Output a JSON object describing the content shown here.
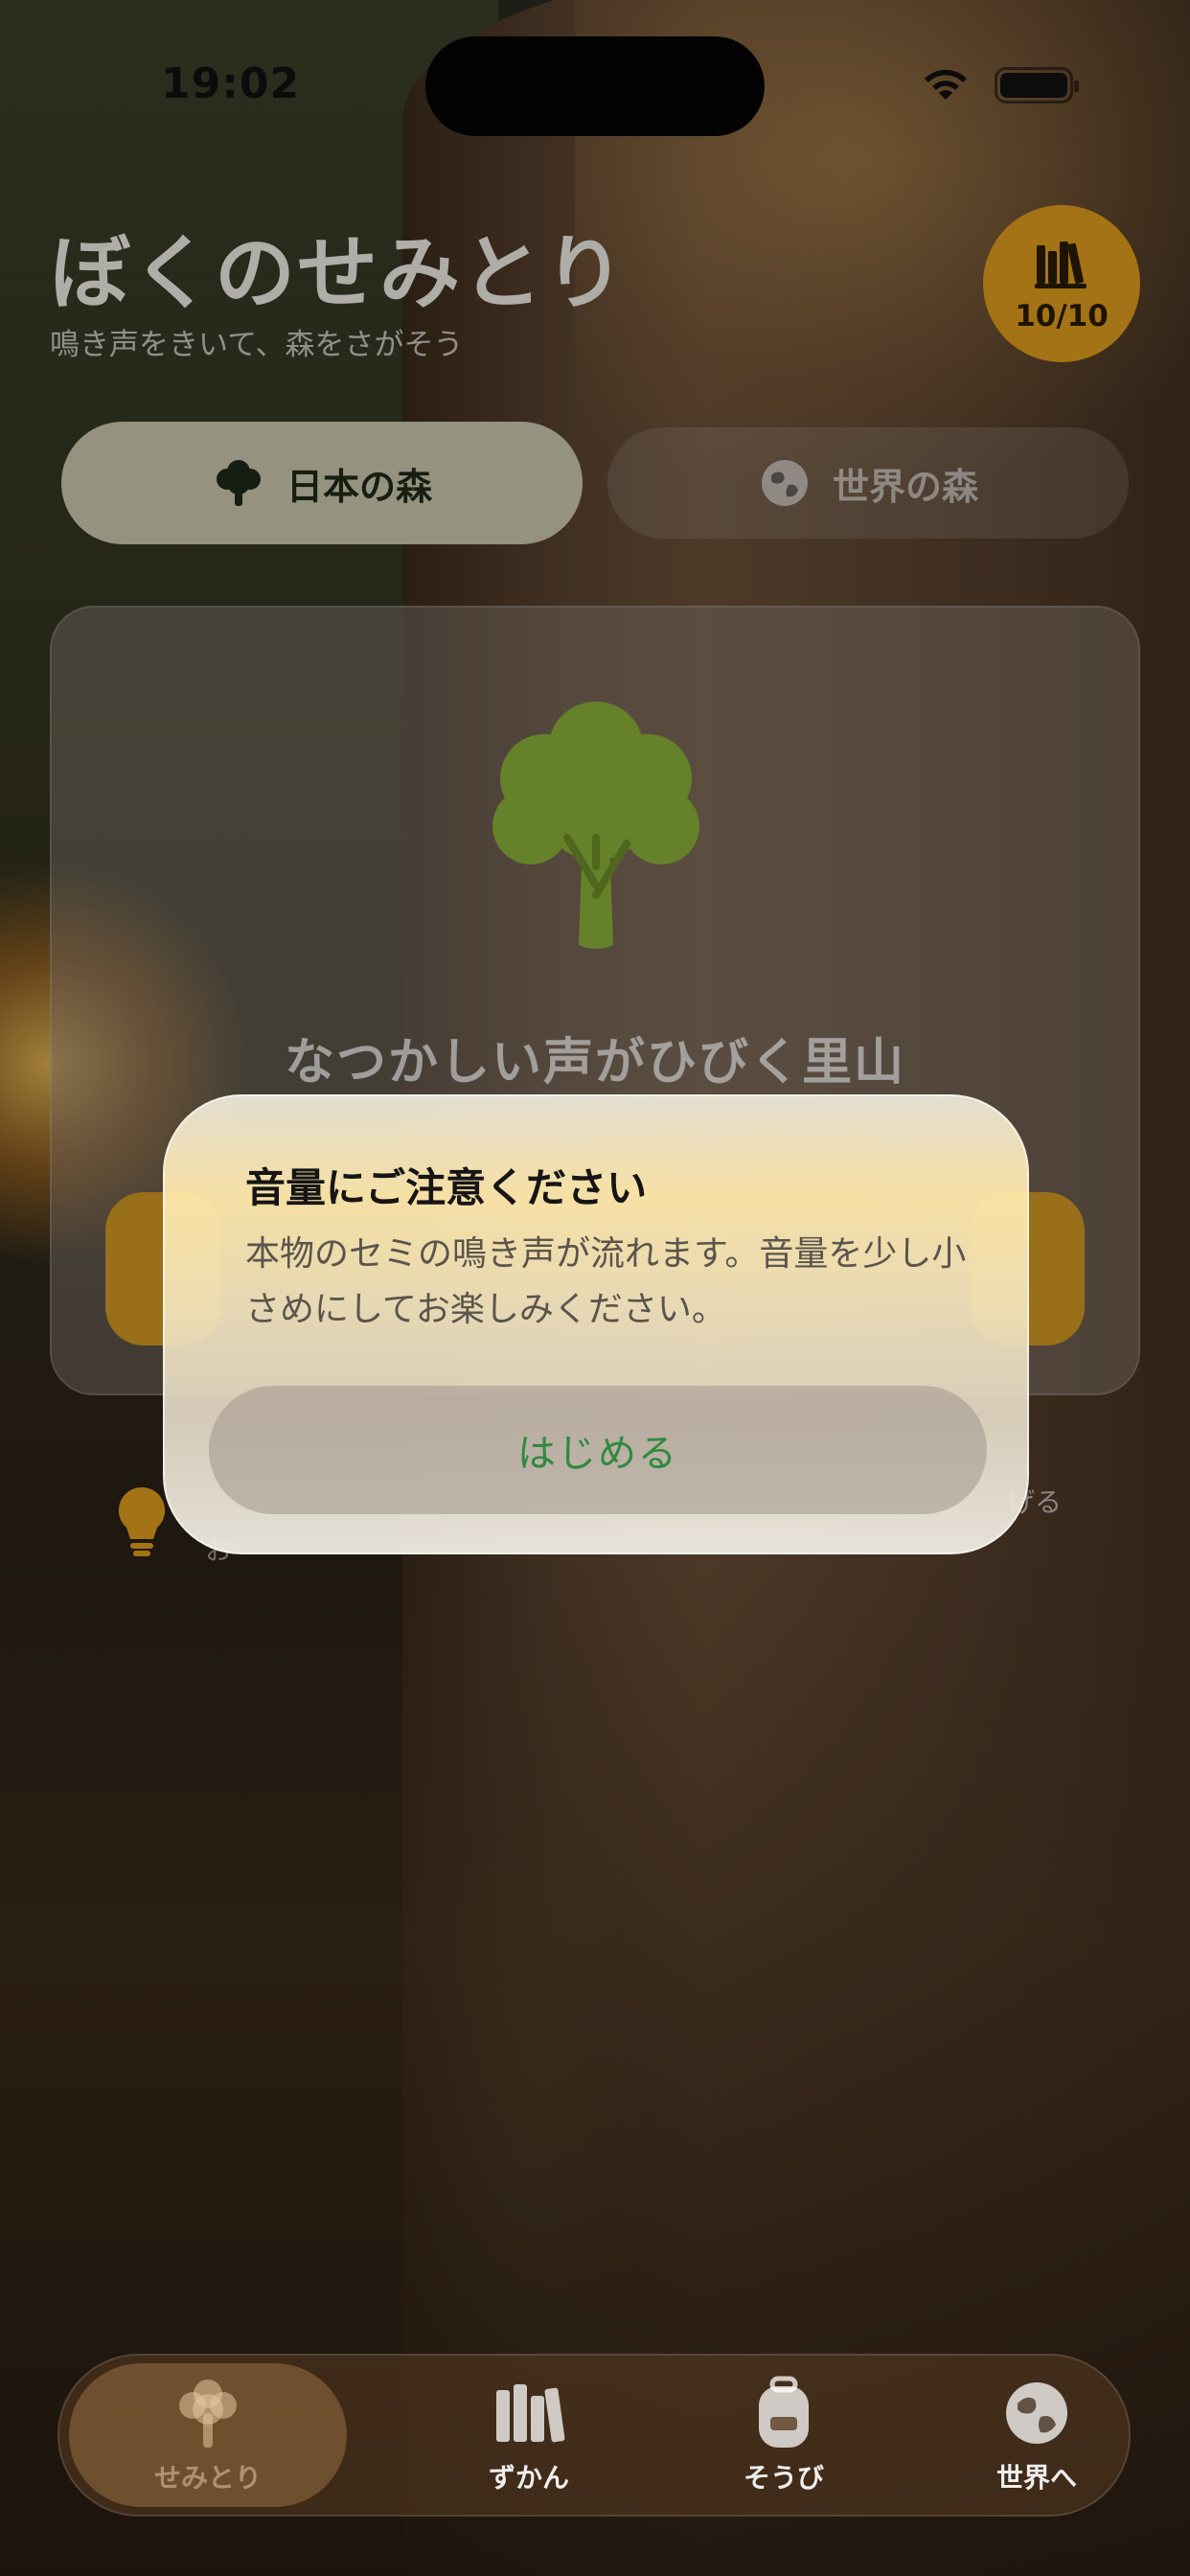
{
  "status_bar": {
    "time": "19:02"
  },
  "header": {
    "title": "ぼくのせみとり",
    "subtitle": "鳴き声をきいて、森をさがそう",
    "collection_badge": {
      "icon": "books-icon",
      "count": "10/10",
      "color": "#e3a01e"
    }
  },
  "segments": [
    {
      "label": "日本の森",
      "icon": "tree-icon",
      "active": true
    },
    {
      "label": "世界の森",
      "icon": "globe-icon",
      "active": false
    }
  ],
  "card": {
    "icon": "tree-icon",
    "icon_color": "#8db33a",
    "place_name": "なつかしい声がひびく里山"
  },
  "hint": {
    "icon": "lightbulb-icon",
    "right_text": "げる",
    "left_text": "お"
  },
  "dialog": {
    "title": "音量にご注意ください",
    "body": "本物のセミの鳴き声が流れます。音量を少し小さめにしてお楽しみください。",
    "button_label": "はじめる",
    "button_color": "#2f8a3e"
  },
  "tab_bar": {
    "items": [
      {
        "label": "せみとり",
        "icon": "tree-icon",
        "selected": true
      },
      {
        "label": "ずかん",
        "icon": "books-icon",
        "selected": false
      },
      {
        "label": "そうび",
        "icon": "backpack-icon",
        "selected": false
      },
      {
        "label": "世界へ",
        "icon": "globe-icon",
        "selected": false
      }
    ]
  }
}
